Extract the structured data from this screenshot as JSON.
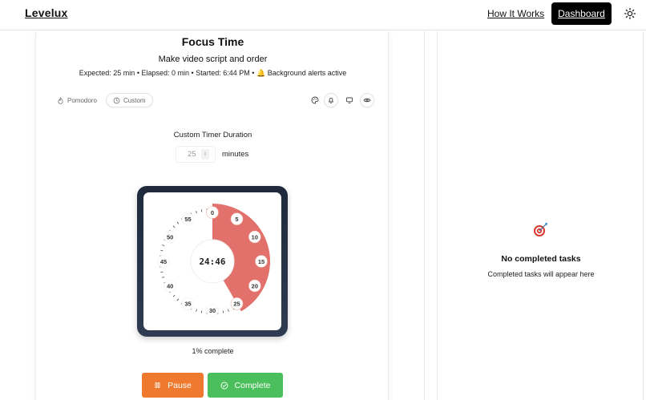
{
  "header": {
    "brand": "Levelux",
    "nav_how": "How It Works",
    "nav_dashboard": "Dashboard",
    "theme_icon": "sun-icon"
  },
  "timer": {
    "title": "Focus Time",
    "task": "Make video script and order",
    "meta_expected": "Expected: 25 min",
    "meta_elapsed": "Elapsed: 0 min",
    "meta_started": "Started: 6:44 PM",
    "meta_alerts": "Background alerts active",
    "meta_sep": "•",
    "bell_glyph": "🔔",
    "modes": {
      "pomodoro": "Pomodoro",
      "custom": "Custom"
    },
    "duration_label": "Custom Timer Duration",
    "duration_value": "25",
    "duration_unit": "minutes",
    "time_remaining": "24:46",
    "set_minutes": 25,
    "progress_text": "1% complete",
    "progress_percent": 1,
    "clock_accent": "#e2716b",
    "dial_labels": [
      "0",
      "5",
      "10",
      "15",
      "20",
      "25",
      "30",
      "35",
      "40",
      "45",
      "50",
      "55"
    ],
    "pause_label": "Pause",
    "complete_label": "Complete",
    "pause_color": "#ef7a2f",
    "complete_color": "#4bbf5c"
  },
  "completed": {
    "icon": "target-icon",
    "title": "No completed tasks",
    "subtitle": "Completed tasks will appear here"
  }
}
